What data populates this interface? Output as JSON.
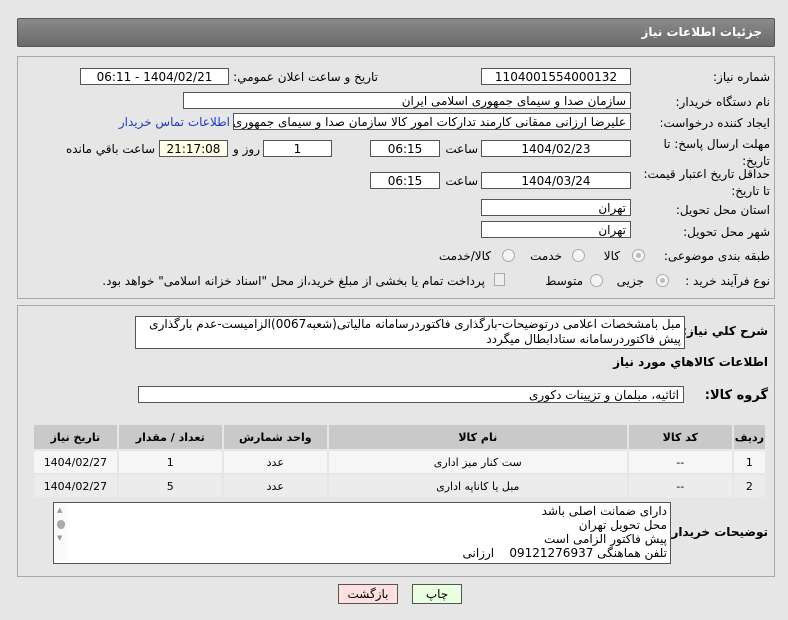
{
  "header": {
    "title": "جزئیات اطلاعات نیاز"
  },
  "form": {
    "need_number_label": "شماره نیاز:",
    "need_number": "1104001554000132",
    "announce_label": "تاریخ و ساعت اعلان عمومي:",
    "announce_value": "1404/02/21 - 06:11",
    "buyer_org_label": "نام دستگاه خريدار:",
    "buyer_org": "سازمان صدا و سیمای جمهوری اسلامی ایران",
    "creator_label": "ایجاد کننده درخواست:",
    "creator": "علیرضا ارزانی ممقانی کارمند تدارکات امور کالا سازمان صدا و سیمای جمهوری ار",
    "contact_link": "اطلاعات تماس خریدار",
    "deadline_label": "مهلت ارسال پاسخ: تا تاریخ:",
    "deadline_date": "1404/02/23",
    "time_label": "ساعت",
    "deadline_time": "06:15",
    "days": "1",
    "days_label": "روز و",
    "remaining": "21:17:08",
    "remaining_label": "ساعت باقي مانده",
    "validity_label": "حداقل تاریخ اعتبار قیمت: تا تاریخ:",
    "validity_date": "1404/03/24",
    "validity_time": "06:15",
    "province_label": "استان محل تحویل:",
    "province": "تهران",
    "city_label": "شهر محل تحویل:",
    "city": "تهران",
    "category_label": "طبقه بندی موضوعی:",
    "category_options": [
      "کالا",
      "خدمت",
      "کالا/خدمت"
    ],
    "process_label": "نوع فرآیند خرید :",
    "process_options": [
      "جزیی",
      "متوسط"
    ],
    "payment_note": "پرداخت تمام یا بخشی از مبلغ خرید،از محل \"اسناد خزانه اسلامی\" خواهد بود."
  },
  "description": {
    "label": "شرح کلي نياز:",
    "text": "مبل بامشخصات اعلامی درتوضیحات-بارگذاری فاکتوردرسامانه مالیاتی(شعبه0067)الزامیست-عدم بارگذاری پیش فاکتوردرسامانه ستادابطال میگردد"
  },
  "goods": {
    "section_title": "اطلاعات کالاهاي مورد نياز",
    "group_label": "گروه کالا:",
    "group": "اثاثیه، مبلمان و تزیینات دکوری",
    "columns": [
      "ردیف",
      "کد کالا",
      "نام کالا",
      "واحد شمارش",
      "تعداد / مقدار",
      "تاریخ نیاز"
    ],
    "rows": [
      {
        "idx": "1",
        "code": "--",
        "name": "ست کنار میز اداری",
        "unit": "عدد",
        "qty": "1",
        "date": "1404/02/27"
      },
      {
        "idx": "2",
        "code": "--",
        "name": "مبل یا کاناپه اداری",
        "unit": "عدد",
        "qty": "5",
        "date": "1404/02/27"
      }
    ]
  },
  "buyer_notes": {
    "label": "توضیحات خریدار:",
    "lines": [
      "دارای ضمانت اصلی باشد",
      "محل تحویل تهران",
      "پیش فاکتور الزامی است",
      "تلفن هماهنگی 09121276937    ارزانی"
    ]
  },
  "buttons": {
    "print": "چاپ",
    "back": "بازگشت"
  }
}
